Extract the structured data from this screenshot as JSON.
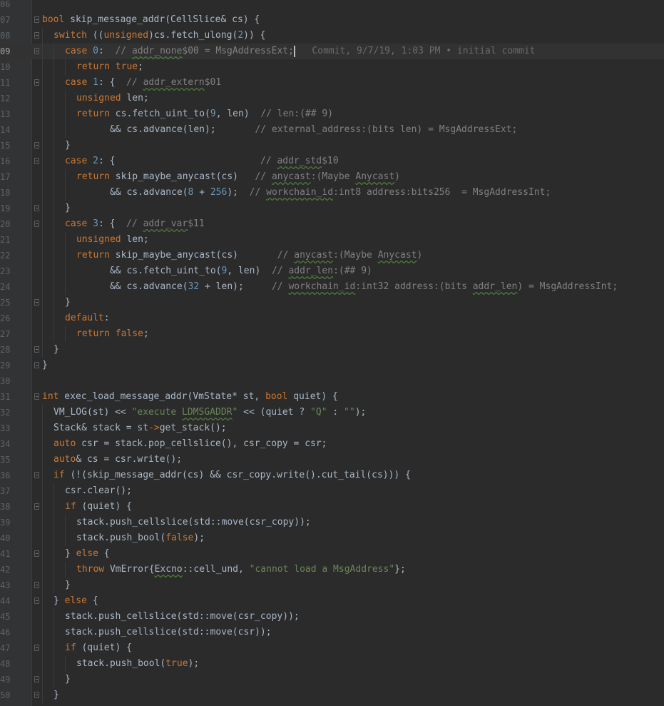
{
  "editor": {
    "current_line": "09",
    "blame": "Commit, 9/7/19, 1:03 PM • initial commit",
    "lines": [
      {
        "n": "06",
        "indent": 0,
        "fold": false,
        "t": []
      },
      {
        "n": "07",
        "indent": 0,
        "fold": true,
        "t": [
          [
            "kw",
            "bool"
          ],
          [
            "p",
            " skip_message_addr(CellSlice& cs) {"
          ]
        ]
      },
      {
        "n": "08",
        "indent": 1,
        "fold": true,
        "t": [
          [
            "kw",
            "switch"
          ],
          [
            "p",
            " (("
          ],
          [
            "kw",
            "unsigned"
          ],
          [
            "p",
            ")cs.fetch_ulong("
          ],
          [
            "num-lit",
            "2"
          ],
          [
            "p",
            ")) {"
          ]
        ]
      },
      {
        "n": "09",
        "indent": 2,
        "fold": true,
        "current": true,
        "t": [
          [
            "kw",
            "case"
          ],
          [
            "p",
            " "
          ],
          [
            "num-lit",
            "0"
          ],
          [
            "p",
            ":  "
          ],
          [
            "cmt",
            "// "
          ],
          [
            "cmt typo",
            "addr_none"
          ],
          [
            "cmt",
            "$00 = MsgAddressExt;"
          ],
          [
            "caret",
            ""
          ],
          [
            "blame",
            "   Commit, 9/7/19, 1:03 PM • initial commit"
          ]
        ]
      },
      {
        "n": "10",
        "indent": 3,
        "fold": false,
        "t": [
          [
            "kw",
            "return"
          ],
          [
            "p",
            " "
          ],
          [
            "kw",
            "true"
          ],
          [
            "p",
            ";"
          ]
        ]
      },
      {
        "n": "11",
        "indent": 2,
        "fold": true,
        "t": [
          [
            "kw",
            "case"
          ],
          [
            "p",
            " "
          ],
          [
            "num-lit",
            "1"
          ],
          [
            "p",
            ": {  "
          ],
          [
            "cmt",
            "// "
          ],
          [
            "cmt typo",
            "addr_extern"
          ],
          [
            "cmt",
            "$01"
          ]
        ]
      },
      {
        "n": "12",
        "indent": 3,
        "fold": false,
        "t": [
          [
            "kw",
            "unsigned"
          ],
          [
            "p",
            " len;"
          ]
        ]
      },
      {
        "n": "13",
        "indent": 3,
        "fold": false,
        "t": [
          [
            "kw",
            "return"
          ],
          [
            "p",
            " cs.fetch_uint_to("
          ],
          [
            "num-lit",
            "9"
          ],
          [
            "p",
            ", len)  "
          ],
          [
            "cmt",
            "// len:(## 9)"
          ]
        ]
      },
      {
        "n": "14",
        "indent": 3,
        "fold": false,
        "t": [
          [
            "p",
            "      && cs.advance(len);       "
          ],
          [
            "cmt",
            "// external_address:(bits len) = MsgAddressExt;"
          ]
        ]
      },
      {
        "n": "15",
        "indent": 2,
        "fold": true,
        "t": [
          [
            "p",
            "}"
          ]
        ]
      },
      {
        "n": "16",
        "indent": 2,
        "fold": true,
        "t": [
          [
            "kw",
            "case"
          ],
          [
            "p",
            " "
          ],
          [
            "num-lit",
            "2"
          ],
          [
            "p",
            ": {                          "
          ],
          [
            "cmt",
            "// "
          ],
          [
            "cmt typo",
            "addr_std"
          ],
          [
            "cmt",
            "$10"
          ]
        ]
      },
      {
        "n": "17",
        "indent": 3,
        "fold": false,
        "t": [
          [
            "kw",
            "return"
          ],
          [
            "p",
            " skip_maybe_anycast(cs)   "
          ],
          [
            "cmt",
            "// "
          ],
          [
            "cmt typo",
            "anycast"
          ],
          [
            "cmt",
            ":(Maybe "
          ],
          [
            "cmt typo",
            "Anycast"
          ],
          [
            "cmt",
            ")"
          ]
        ]
      },
      {
        "n": "18",
        "indent": 3,
        "fold": false,
        "t": [
          [
            "p",
            "      && cs.advance("
          ],
          [
            "num-lit",
            "8"
          ],
          [
            "p",
            " + "
          ],
          [
            "num-lit",
            "256"
          ],
          [
            "p",
            ");  "
          ],
          [
            "cmt",
            "// "
          ],
          [
            "cmt typo",
            "workchain_id"
          ],
          [
            "cmt",
            ":int8 address:bits256  = MsgAddressInt;"
          ]
        ]
      },
      {
        "n": "19",
        "indent": 2,
        "fold": true,
        "t": [
          [
            "p",
            "}"
          ]
        ]
      },
      {
        "n": "20",
        "indent": 2,
        "fold": true,
        "t": [
          [
            "kw",
            "case"
          ],
          [
            "p",
            " "
          ],
          [
            "num-lit",
            "3"
          ],
          [
            "p",
            ": {  "
          ],
          [
            "cmt",
            "// "
          ],
          [
            "cmt typo",
            "addr_var"
          ],
          [
            "cmt",
            "$11"
          ]
        ]
      },
      {
        "n": "21",
        "indent": 3,
        "fold": false,
        "t": [
          [
            "kw",
            "unsigned"
          ],
          [
            "p",
            " len;"
          ]
        ]
      },
      {
        "n": "22",
        "indent": 3,
        "fold": false,
        "t": [
          [
            "kw",
            "return"
          ],
          [
            "p",
            " skip_maybe_anycast(cs)       "
          ],
          [
            "cmt",
            "// "
          ],
          [
            "cmt typo",
            "anycast"
          ],
          [
            "cmt",
            ":(Maybe "
          ],
          [
            "cmt typo",
            "Anycast"
          ],
          [
            "cmt",
            ")"
          ]
        ]
      },
      {
        "n": "23",
        "indent": 3,
        "fold": false,
        "t": [
          [
            "p",
            "      && cs.fetch_uint_to("
          ],
          [
            "num-lit",
            "9"
          ],
          [
            "p",
            ", len)  "
          ],
          [
            "cmt",
            "// "
          ],
          [
            "cmt typo",
            "addr_len"
          ],
          [
            "cmt",
            ":(## 9)"
          ]
        ]
      },
      {
        "n": "24",
        "indent": 3,
        "fold": false,
        "t": [
          [
            "p",
            "      && cs.advance("
          ],
          [
            "num-lit",
            "32"
          ],
          [
            "p",
            " + len);     "
          ],
          [
            "cmt",
            "// "
          ],
          [
            "cmt typo",
            "workchain_id"
          ],
          [
            "cmt",
            ":int32 address:(bits "
          ],
          [
            "cmt typo",
            "addr_len"
          ],
          [
            "cmt",
            ") = MsgAddressInt;"
          ]
        ]
      },
      {
        "n": "25",
        "indent": 2,
        "fold": true,
        "t": [
          [
            "p",
            "}"
          ]
        ]
      },
      {
        "n": "26",
        "indent": 2,
        "fold": false,
        "t": [
          [
            "kw",
            "default"
          ],
          [
            "p",
            ":"
          ]
        ]
      },
      {
        "n": "27",
        "indent": 3,
        "fold": false,
        "t": [
          [
            "kw",
            "return"
          ],
          [
            "p",
            " "
          ],
          [
            "kw",
            "false"
          ],
          [
            "p",
            ";"
          ]
        ]
      },
      {
        "n": "28",
        "indent": 1,
        "fold": true,
        "t": [
          [
            "p",
            "}"
          ]
        ]
      },
      {
        "n": "29",
        "indent": 0,
        "fold": true,
        "t": [
          [
            "p",
            "}"
          ]
        ]
      },
      {
        "n": "30",
        "indent": 0,
        "fold": false,
        "t": []
      },
      {
        "n": "31",
        "indent": 0,
        "fold": true,
        "t": [
          [
            "kw",
            "int"
          ],
          [
            "p",
            " exec_load_message_addr(VmState* st, "
          ],
          [
            "kw",
            "bool"
          ],
          [
            "p",
            " quiet) {"
          ]
        ]
      },
      {
        "n": "32",
        "indent": 1,
        "fold": false,
        "t": [
          [
            "p",
            "VM_LOG(st) << "
          ],
          [
            "str",
            "\"execute "
          ],
          [
            "str typo",
            "LDMSGADDR"
          ],
          [
            "str",
            "\""
          ],
          [
            "p",
            " << (quiet ? "
          ],
          [
            "str",
            "\"Q\""
          ],
          [
            "p",
            " : "
          ],
          [
            "str",
            "\"\""
          ],
          [
            "p",
            ");"
          ]
        ]
      },
      {
        "n": "33",
        "indent": 1,
        "fold": false,
        "t": [
          [
            "p",
            "Stack& stack = st"
          ],
          [
            "kw",
            "->"
          ],
          [
            "p",
            "get_stack();"
          ]
        ]
      },
      {
        "n": "34",
        "indent": 1,
        "fold": false,
        "t": [
          [
            "kw",
            "auto"
          ],
          [
            "p",
            " csr = stack.pop_cellslice(), csr_copy = csr;"
          ]
        ]
      },
      {
        "n": "35",
        "indent": 1,
        "fold": false,
        "t": [
          [
            "kw",
            "auto"
          ],
          [
            "p",
            "& cs = csr.write();"
          ]
        ]
      },
      {
        "n": "36",
        "indent": 1,
        "fold": true,
        "t": [
          [
            "kw",
            "if"
          ],
          [
            "p",
            " (!(skip_message_addr(cs) && csr_copy.write().cut_tail(cs))) {"
          ]
        ]
      },
      {
        "n": "37",
        "indent": 2,
        "fold": false,
        "t": [
          [
            "p",
            "csr.clear();"
          ]
        ]
      },
      {
        "n": "38",
        "indent": 2,
        "fold": true,
        "t": [
          [
            "kw",
            "if"
          ],
          [
            "p",
            " (quiet) {"
          ]
        ]
      },
      {
        "n": "39",
        "indent": 3,
        "fold": false,
        "t": [
          [
            "p",
            "stack.push_cellslice(std::move(csr_copy));"
          ]
        ]
      },
      {
        "n": "40",
        "indent": 3,
        "fold": false,
        "t": [
          [
            "p",
            "stack.push_bool("
          ],
          [
            "kw",
            "false"
          ],
          [
            "p",
            ");"
          ]
        ]
      },
      {
        "n": "41",
        "indent": 2,
        "fold": true,
        "t": [
          [
            "p",
            "} "
          ],
          [
            "kw",
            "else"
          ],
          [
            "p",
            " {"
          ]
        ]
      },
      {
        "n": "42",
        "indent": 3,
        "fold": false,
        "t": [
          [
            "kw",
            "throw"
          ],
          [
            "p",
            " VmError{"
          ],
          [
            "p typo",
            "Excno"
          ],
          [
            "p",
            "::cell_und, "
          ],
          [
            "str",
            "\"cannot load a MsgAddress\""
          ],
          [
            "p",
            "};"
          ]
        ]
      },
      {
        "n": "43",
        "indent": 2,
        "fold": true,
        "t": [
          [
            "p",
            "}"
          ]
        ]
      },
      {
        "n": "44",
        "indent": 1,
        "fold": true,
        "t": [
          [
            "p",
            "} "
          ],
          [
            "kw",
            "else"
          ],
          [
            "p",
            " {"
          ]
        ]
      },
      {
        "n": "45",
        "indent": 2,
        "fold": false,
        "t": [
          [
            "p",
            "stack.push_cellslice(std::move(csr_copy));"
          ]
        ]
      },
      {
        "n": "46",
        "indent": 2,
        "fold": false,
        "t": [
          [
            "p",
            "stack.push_cellslice(std::move(csr));"
          ]
        ]
      },
      {
        "n": "47",
        "indent": 2,
        "fold": true,
        "t": [
          [
            "kw",
            "if"
          ],
          [
            "p",
            " (quiet) {"
          ]
        ]
      },
      {
        "n": "48",
        "indent": 3,
        "fold": false,
        "t": [
          [
            "p",
            "stack.push_bool("
          ],
          [
            "kw",
            "true"
          ],
          [
            "p",
            ");"
          ]
        ]
      },
      {
        "n": "49",
        "indent": 2,
        "fold": true,
        "t": [
          [
            "p",
            "}"
          ]
        ]
      },
      {
        "n": "50",
        "indent": 1,
        "fold": true,
        "t": [
          [
            "p",
            "}"
          ]
        ]
      }
    ]
  }
}
